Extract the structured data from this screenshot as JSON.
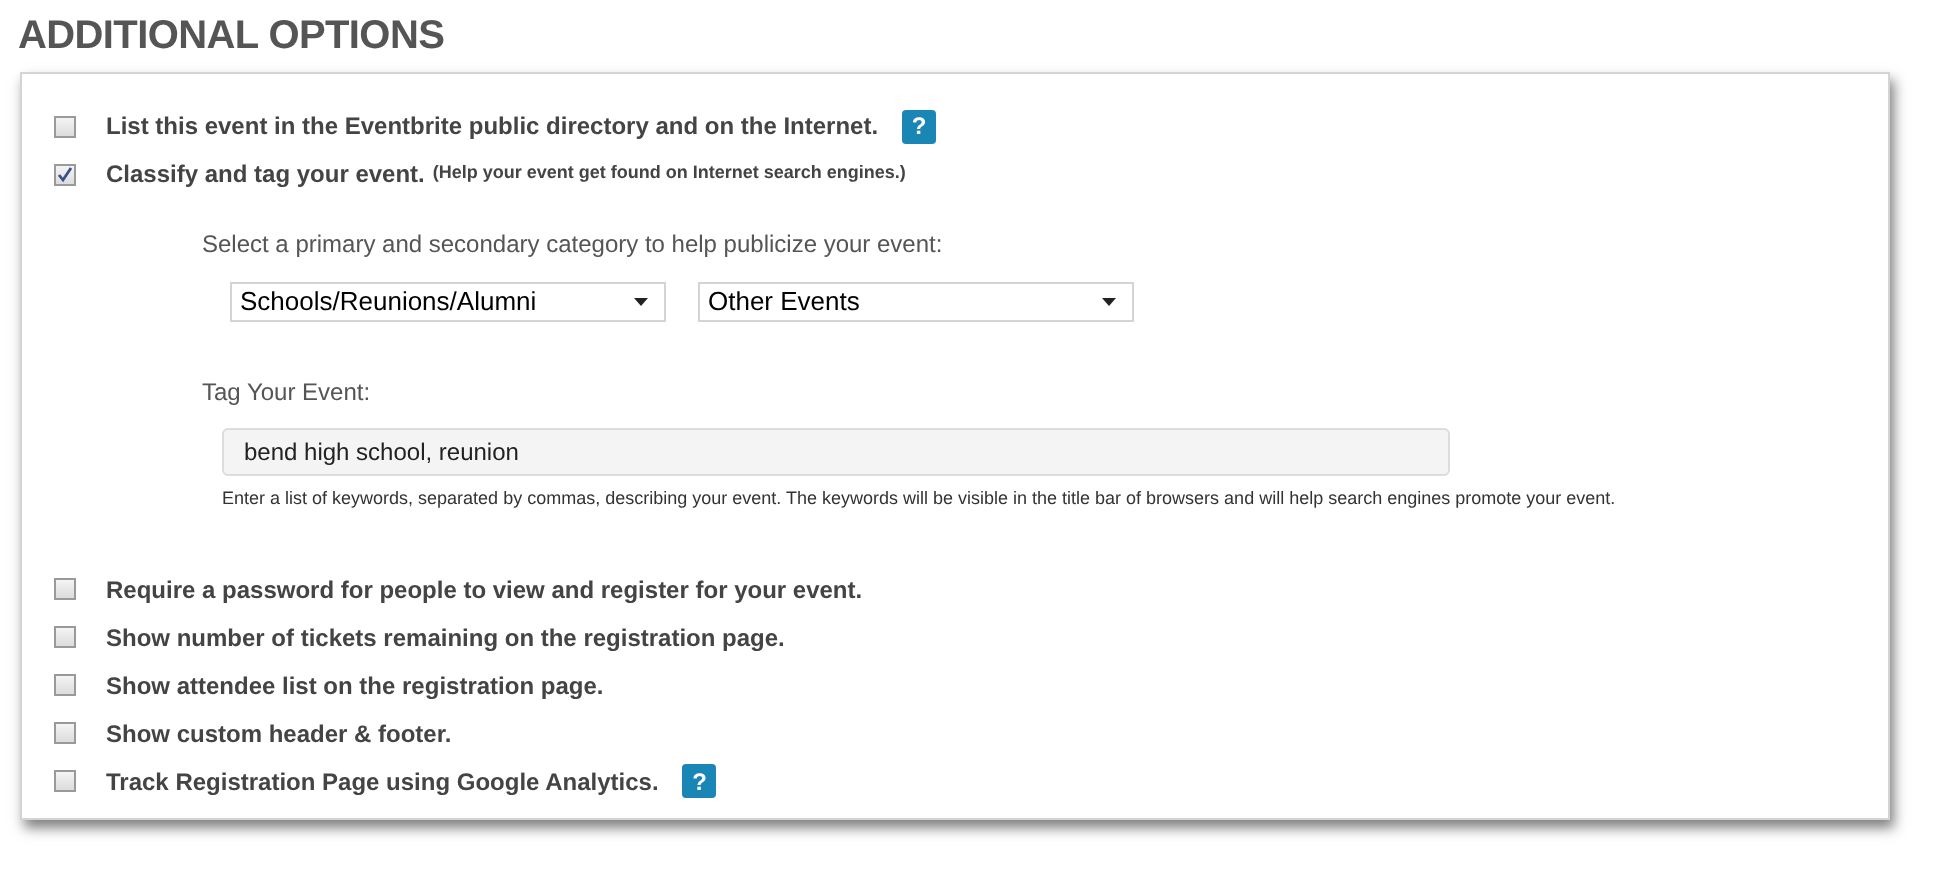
{
  "title": "ADDITIONAL OPTIONS",
  "options": [
    {
      "label": "List this event in the Eventbrite public directory and on the Internet.",
      "checked": false,
      "help": "?"
    },
    {
      "label": "Classify and tag your event.",
      "note": "(Help your event get found on Internet search engines.)",
      "checked": true,
      "details": {
        "category_prompt": "Select a primary and secondary category to help publicize your event:",
        "primary_category": "Schools/Reunions/Alumni",
        "secondary_category": "Other Events",
        "tag_label": "Tag Your Event:",
        "tag_value": "bend high school, reunion",
        "tag_hint": "Enter a list of keywords, separated by commas, describing your event. The keywords will be visible in the title bar of browsers and will help search engines promote your event."
      }
    },
    {
      "label": "Require a password for people to view and register for your event.",
      "checked": false
    },
    {
      "label": "Show number of tickets remaining on the registration page.",
      "checked": false
    },
    {
      "label": "Show attendee list on the registration page.",
      "checked": false
    },
    {
      "label": "Show custom header & footer.",
      "checked": false
    },
    {
      "label": "Track Registration Page using Google Analytics.",
      "checked": false,
      "help": "?"
    }
  ]
}
